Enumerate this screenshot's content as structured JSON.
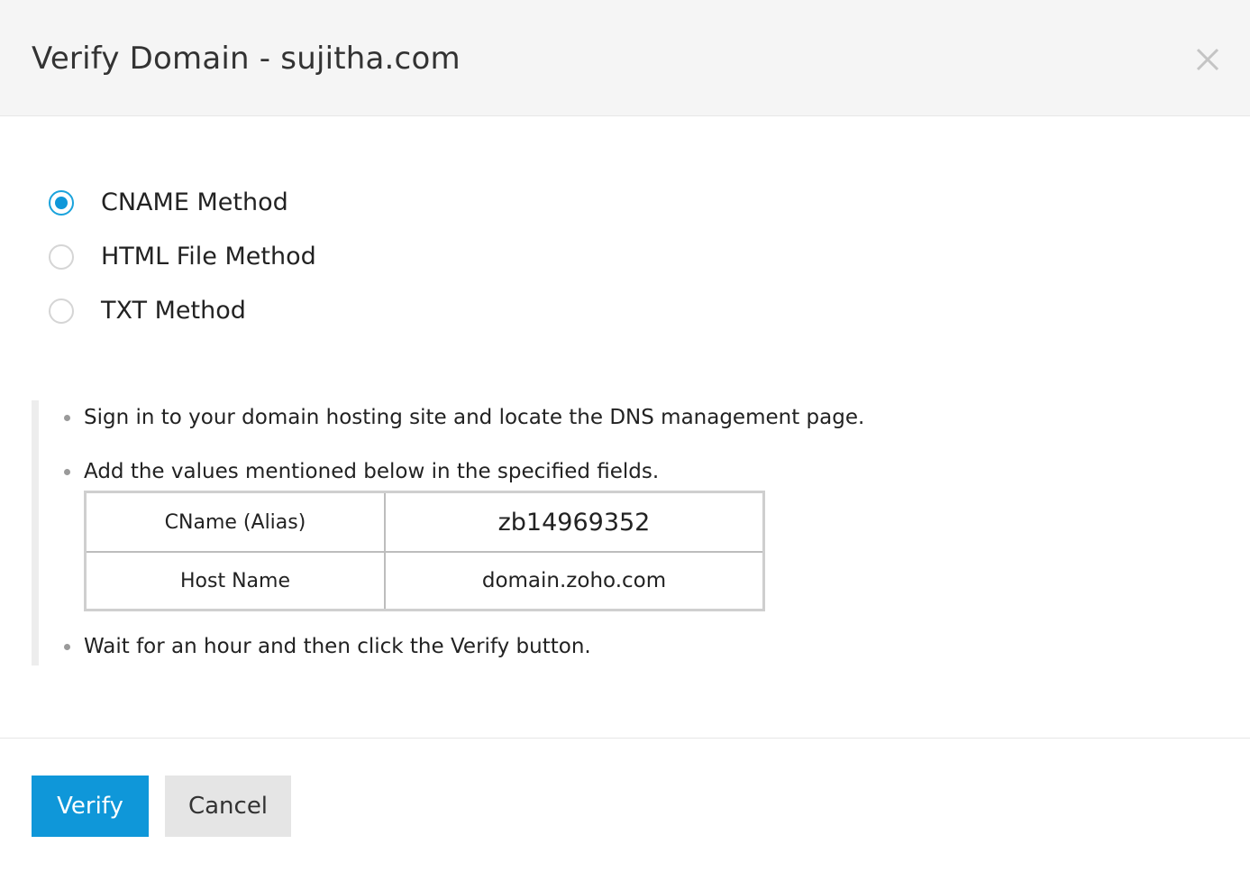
{
  "dialog": {
    "title": "Verify Domain - sujitha.com",
    "close_icon": "close-icon"
  },
  "methods": [
    {
      "label": "CNAME Method",
      "selected": true
    },
    {
      "label": "HTML File Method",
      "selected": false
    },
    {
      "label": "TXT Method",
      "selected": false
    }
  ],
  "instructions": {
    "step_1": "Sign in to your domain hosting site and locate the DNS management page.",
    "step_2": "Add the values mentioned below in the specified fields.",
    "step_3": "Wait for an hour and then click the Verify button."
  },
  "dns_table": {
    "rows": [
      {
        "key": "CName (Alias)",
        "value": "zb14969352"
      },
      {
        "key": "Host Name",
        "value": "domain.zoho.com"
      }
    ]
  },
  "footer": {
    "verify_label": "Verify",
    "cancel_label": "Cancel"
  },
  "colors": {
    "accent": "#0f97d9",
    "header_bg": "#f5f5f5",
    "cancel_bg": "#e5e5e5"
  }
}
